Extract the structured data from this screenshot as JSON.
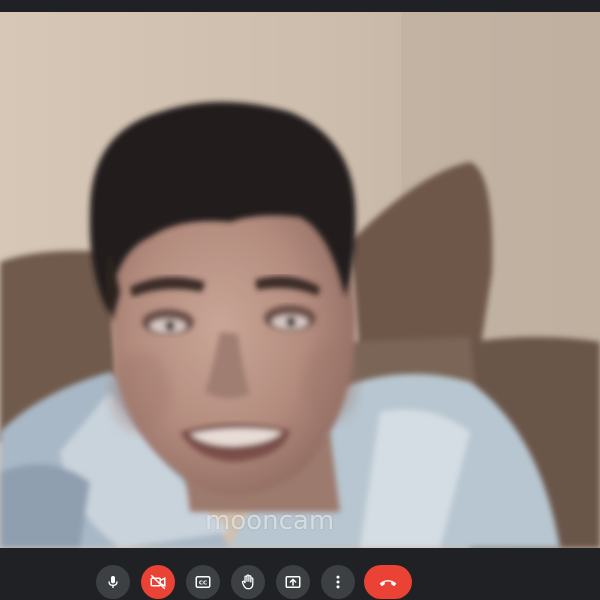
{
  "video": {
    "watermark_text": "mooncam"
  },
  "controls": [
    {
      "name": "microphone",
      "icon": "microphone-icon",
      "color": "#3c4043"
    },
    {
      "name": "camera-off",
      "icon": "camera-off-icon",
      "color": "#ea4335"
    },
    {
      "name": "captions",
      "icon": "closed-captions-icon",
      "label": "CC",
      "color": "#3c4043"
    },
    {
      "name": "raise-hand",
      "icon": "hand-icon",
      "color": "#3c4043"
    },
    {
      "name": "present-screen",
      "icon": "present-upload-icon",
      "color": "#3c4043"
    },
    {
      "name": "more-options",
      "icon": "more-vertical-icon",
      "color": "#3c4043"
    },
    {
      "name": "end-call",
      "icon": "hang-up-phone-icon",
      "color": "#ea4335"
    }
  ],
  "theme": {
    "background": "#202124",
    "button": "#3c4043",
    "danger": "#ea4335"
  }
}
